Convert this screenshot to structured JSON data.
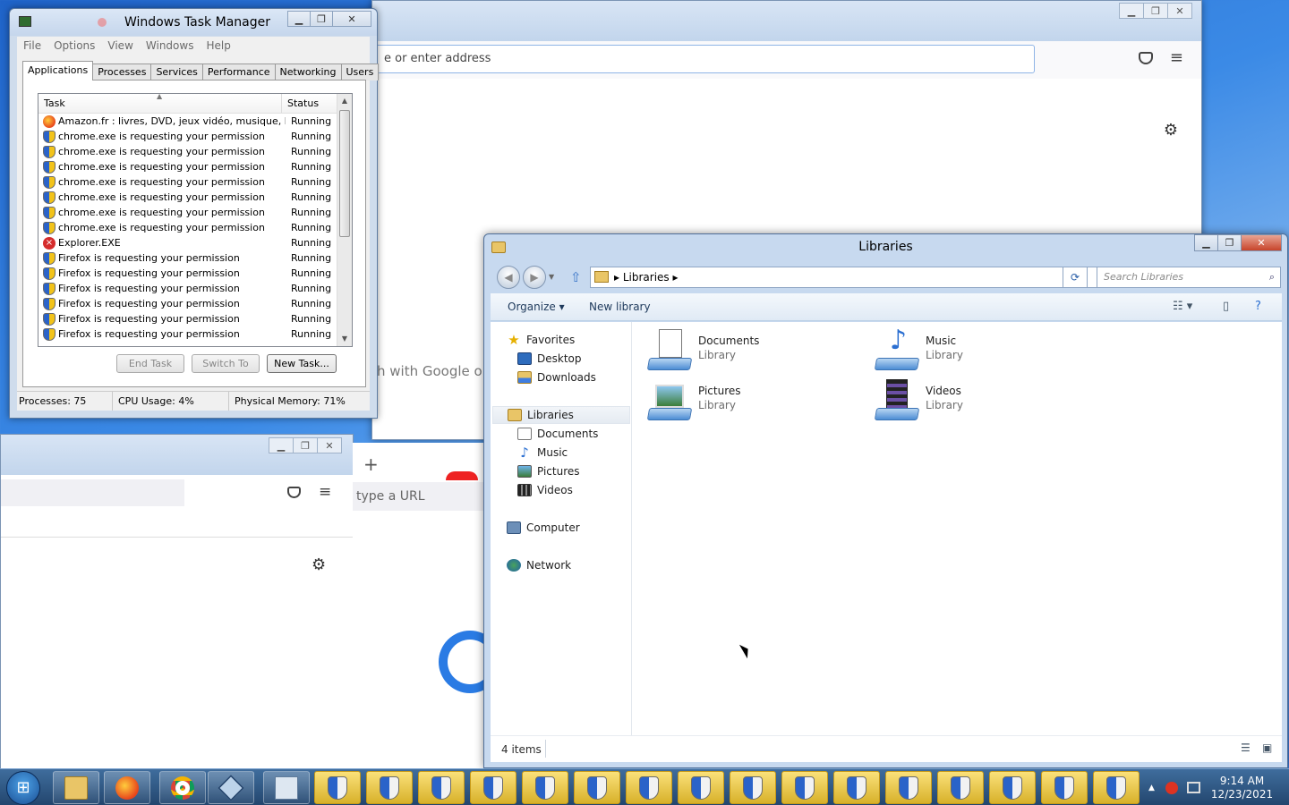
{
  "firefox_back": {
    "address_placeholder": "e or enter address",
    "search_hint": "h with Google or"
  },
  "firefox_2": {},
  "firefox_3": {
    "address_placeholder": "type a URL"
  },
  "task_manager": {
    "title": "Windows Task Manager",
    "menu": [
      "File",
      "Options",
      "View",
      "Windows",
      "Help"
    ],
    "tabs": [
      "Applications",
      "Processes",
      "Services",
      "Performance",
      "Networking",
      "Users"
    ],
    "active_tab": "Applications",
    "columns": {
      "task": "Task",
      "status": "Status"
    },
    "rows": [
      {
        "task": "Amazon.fr : livres, DVD, jeux vidéo, musique, hi...",
        "status": "Running",
        "icon": "firefox-icon"
      },
      {
        "task": "chrome.exe is requesting your permission",
        "status": "Running",
        "icon": "uac-shield-icon"
      },
      {
        "task": "chrome.exe is requesting your permission",
        "status": "Running",
        "icon": "uac-shield-icon"
      },
      {
        "task": "chrome.exe is requesting your permission",
        "status": "Running",
        "icon": "uac-shield-icon"
      },
      {
        "task": "chrome.exe is requesting your permission",
        "status": "Running",
        "icon": "uac-shield-icon"
      },
      {
        "task": "chrome.exe is requesting your permission",
        "status": "Running",
        "icon": "uac-shield-icon"
      },
      {
        "task": "chrome.exe is requesting your permission",
        "status": "Running",
        "icon": "uac-shield-icon"
      },
      {
        "task": "chrome.exe is requesting your permission",
        "status": "Running",
        "icon": "uac-shield-icon"
      },
      {
        "task": "Explorer.EXE",
        "status": "Running",
        "icon": "error-icon"
      },
      {
        "task": "Firefox is requesting your permission",
        "status": "Running",
        "icon": "uac-shield-icon"
      },
      {
        "task": "Firefox is requesting your permission",
        "status": "Running",
        "icon": "uac-shield-icon"
      },
      {
        "task": "Firefox is requesting your permission",
        "status": "Running",
        "icon": "uac-shield-icon"
      },
      {
        "task": "Firefox is requesting your permission",
        "status": "Running",
        "icon": "uac-shield-icon"
      },
      {
        "task": "Firefox is requesting your permission",
        "status": "Running",
        "icon": "uac-shield-icon"
      },
      {
        "task": "Firefox is requesting your permission",
        "status": "Running",
        "icon": "uac-shield-icon"
      }
    ],
    "buttons": {
      "end_task": "End Task",
      "switch_to": "Switch To",
      "new_task": "New Task..."
    },
    "status_bar": {
      "processes": "Processes: 75",
      "cpu": "CPU Usage: 4%",
      "memory": "Physical Memory: 71%"
    }
  },
  "explorer": {
    "title": "Libraries",
    "breadcrumb": "Libraries",
    "search_placeholder": "Search Libraries",
    "commands": {
      "organize": "Organize",
      "new_library": "New library"
    },
    "nav": {
      "favorites": "Favorites",
      "desktop": "Desktop",
      "downloads": "Downloads",
      "libraries": "Libraries",
      "documents": "Documents",
      "music": "Music",
      "pictures": "Pictures",
      "videos": "Videos",
      "computer": "Computer",
      "network": "Network"
    },
    "items": [
      {
        "name": "Documents",
        "type": "Library"
      },
      {
        "name": "Music",
        "type": "Library"
      },
      {
        "name": "Pictures",
        "type": "Library"
      },
      {
        "name": "Videos",
        "type": "Library"
      }
    ],
    "status": "4 items"
  },
  "taskbar": {
    "clock_time": "9:14 AM",
    "clock_date": "12/23/2021",
    "shield_buttons": 16
  },
  "colors": {
    "taskbar": "#23466e",
    "explorer_frame": "#c7d9ef",
    "uac_shield": "#f2c31a"
  }
}
